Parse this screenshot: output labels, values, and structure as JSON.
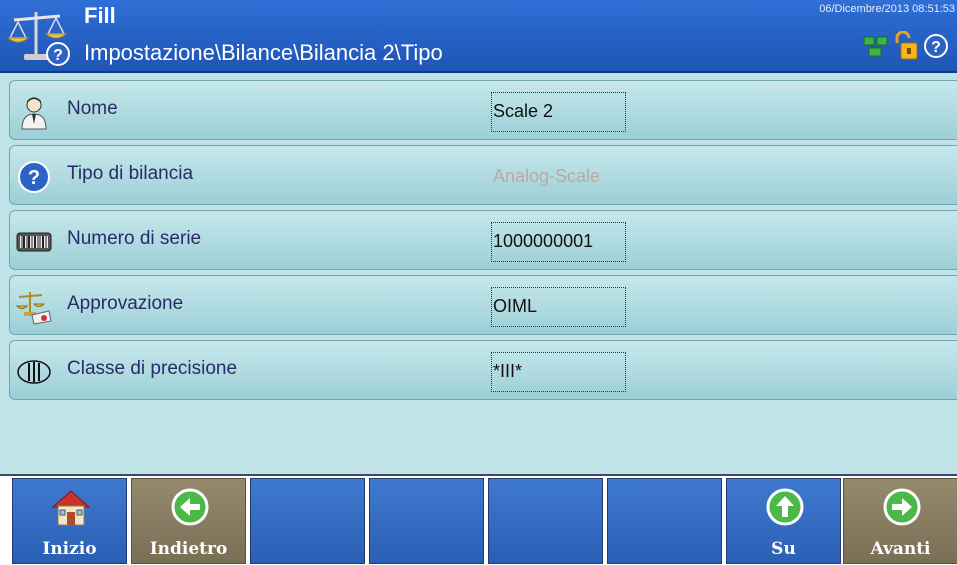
{
  "header": {
    "app_title": "Fill",
    "breadcrumb": "Impostazione\\Bilance\\Bilancia 2\\Tipo",
    "datetime": "06/Dicembre/2013 08:51:53",
    "icons": [
      "scale-help-icon",
      "network-icon",
      "padlock-unlocked-icon",
      "help-icon"
    ]
  },
  "rows": [
    {
      "label": "Nome",
      "value": "Scale 2",
      "icon": "user-icon",
      "editable": true
    },
    {
      "label": "Tipo di bilancia",
      "value": "Analog-Scale",
      "icon": "help-icon",
      "editable": false
    },
    {
      "label": "Numero di serie",
      "value": "1000000001",
      "icon": "barcode-icon",
      "editable": true
    },
    {
      "label": "Approvazione",
      "value": "OIML",
      "icon": "approval-scale-icon",
      "editable": true
    },
    {
      "label": "Classe di precisione",
      "value": "*III*",
      "icon": "precision-class-icon",
      "editable": true
    }
  ],
  "footer": {
    "buttons": [
      {
        "label": "Inizio",
        "icon": "home-icon"
      },
      {
        "label": "Indietro",
        "icon": "arrow-left-icon"
      },
      {
        "label": "",
        "icon": ""
      },
      {
        "label": "",
        "icon": ""
      },
      {
        "label": "",
        "icon": ""
      },
      {
        "label": "",
        "icon": ""
      },
      {
        "label": "Su",
        "icon": "arrow-up-icon"
      },
      {
        "label": "Avanti",
        "icon": "arrow-right-icon"
      }
    ]
  },
  "colors": {
    "header_bg": "#2a64c8",
    "content_bg": "#bfe3e6",
    "row_bg": "#a8d6dc",
    "footer_blue": "#3366bb",
    "footer_brown": "#8a7f63",
    "disabled_text": "#b9a9a0"
  }
}
